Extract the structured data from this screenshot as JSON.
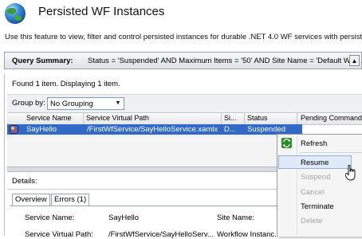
{
  "header": {
    "title": "Persisted WF Instances",
    "description": "Use this feature to view, filter and control persisted instances for durable .NET 4.0 WF services with persisten"
  },
  "query_summary": {
    "label": "Query Summary:",
    "text": "Status = 'Suspended' AND Maximum Items = '50' AND Site Name = 'Default Web ... A"
  },
  "results": {
    "found_text": "Found 1 item. Displaying 1 item.",
    "group_by_label": "Group by:",
    "group_by_value": "No Grouping",
    "columns": [
      "Service Name",
      "Service Virtual Path",
      "Si...",
      "Status",
      "Pending Command"
    ],
    "rows": [
      {
        "service_name": "SayHello",
        "virtual_path": "/FirstWfService/SayHelloService.xamlx",
        "site": "D...",
        "status": "Suspended"
      }
    ]
  },
  "details": {
    "label": "Details:",
    "tabs": [
      "Overview",
      "Errors (1)"
    ],
    "fields": {
      "service_name_label": "Service Name:",
      "service_name_value": "SayHello",
      "site_name_label": "Site Name:",
      "virtual_path_label": "Service Virtual Path:",
      "virtual_path_value": "/FirstWfService/SayHelloServ...",
      "extra_value": "Workflow Instanc..."
    }
  },
  "context_menu": {
    "items": [
      {
        "label": "Refresh",
        "enabled": true
      },
      {
        "label": "Resume",
        "enabled": true,
        "highlighted": true
      },
      {
        "label": "Suspend",
        "enabled": false
      },
      {
        "label": "Cancel",
        "enabled": false
      },
      {
        "label": "Terminate",
        "enabled": true
      },
      {
        "label": "Delete",
        "enabled": false
      }
    ]
  },
  "colors": {
    "selection": "#3169c6",
    "menu_highlight": "#dfe9f7",
    "disabled_text": "#a8a8a8"
  },
  "icons": [
    "globe-icon",
    "chevron-up-icon",
    "dropdown-arrow-icon",
    "workflow-instance-icon",
    "refresh-icon",
    "mouse-cursor-icon"
  ]
}
